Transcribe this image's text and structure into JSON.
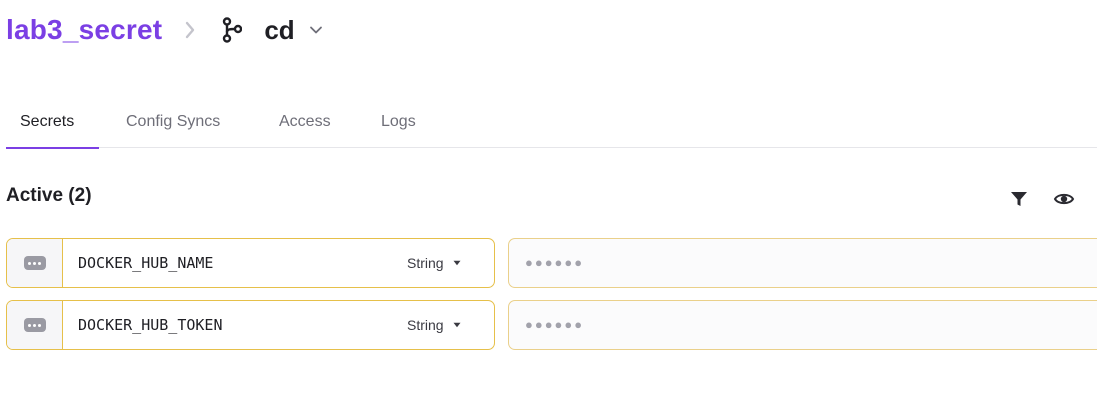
{
  "header": {
    "project": "lab3_secret",
    "environment": "cd"
  },
  "tabs": [
    {
      "label": "Secrets",
      "active": true
    },
    {
      "label": "Config Syncs",
      "active": false
    },
    {
      "label": "Access",
      "active": false
    },
    {
      "label": "Logs",
      "active": false
    }
  ],
  "section": {
    "title": "Active (2)"
  },
  "secrets": [
    {
      "key": "DOCKER_HUB_NAME",
      "type": "String",
      "value_masked": "●●●●●●"
    },
    {
      "key": "DOCKER_HUB_TOKEN",
      "type": "String",
      "value_masked": "●●●●●●"
    }
  ],
  "colors": {
    "accent": "#7b3fe4",
    "row_border": "#e6c04a",
    "text": "#1f1f24"
  },
  "icons": {
    "separator": "chevron-right-icon",
    "branch": "git-branch-icon",
    "dropdown": "chevron-down-icon",
    "filter": "filter-icon",
    "visibility": "eye-icon",
    "row_menu": "more-horizontal-icon",
    "type_caret": "caret-down-icon"
  }
}
